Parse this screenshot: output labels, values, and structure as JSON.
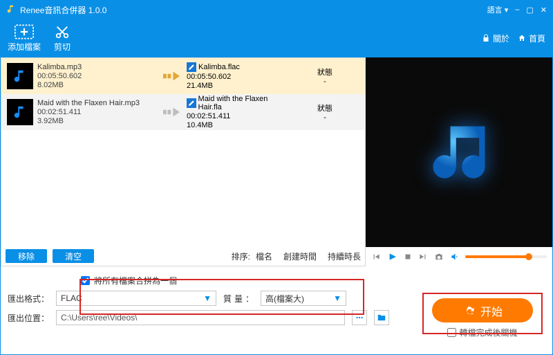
{
  "window": {
    "title": "Renee音訊合併器 1.0.0",
    "language": "語言",
    "min": "–",
    "max": "▢",
    "close": "✕"
  },
  "toolbar": {
    "add": "添加檔案",
    "cut": "剪切",
    "about": "關於",
    "home": "首頁"
  },
  "files": [
    {
      "src_name": "Kalimba.mp3",
      "src_duration": "00:05:50.602",
      "src_size": "8.02MB",
      "dst_name": "Kalimba.flac",
      "dst_duration": "00:05:50.602",
      "dst_size": "21.4MB",
      "status_label": "狀態",
      "status_value": "-",
      "selected": true
    },
    {
      "src_name": "Maid with the Flaxen Hair.mp3",
      "src_duration": "00:02:51.411",
      "src_size": "3.92MB",
      "dst_name": "Maid with the Flaxen Hair.fla",
      "dst_duration": "00:02:51.411",
      "dst_size": "10.4MB",
      "status_label": "狀態",
      "status_value": "-",
      "selected": false
    }
  ],
  "list_controls": {
    "remove": "移除",
    "clear": "清空",
    "sort_prefix": "排序:",
    "sort_name": "檔名",
    "sort_created": "創建時間",
    "sort_duration": "持續時長"
  },
  "output": {
    "merge_label": "將所有檔案合拼為一個",
    "merge_checked": true,
    "format_label": "匯出格式：",
    "format_value": "FLAC",
    "quality_label": "質量：",
    "quality_value": "高(檔案大)",
    "path_label": "匯出位置：",
    "path_value": "C:\\Users\\ree\\Videos\\"
  },
  "start": {
    "button": "开始",
    "after_label": "轉檔完成後關機",
    "after_checked": false
  },
  "colors": {
    "primary": "#0a8fe6",
    "accent": "#ff7a00",
    "danger": "#d62424"
  }
}
